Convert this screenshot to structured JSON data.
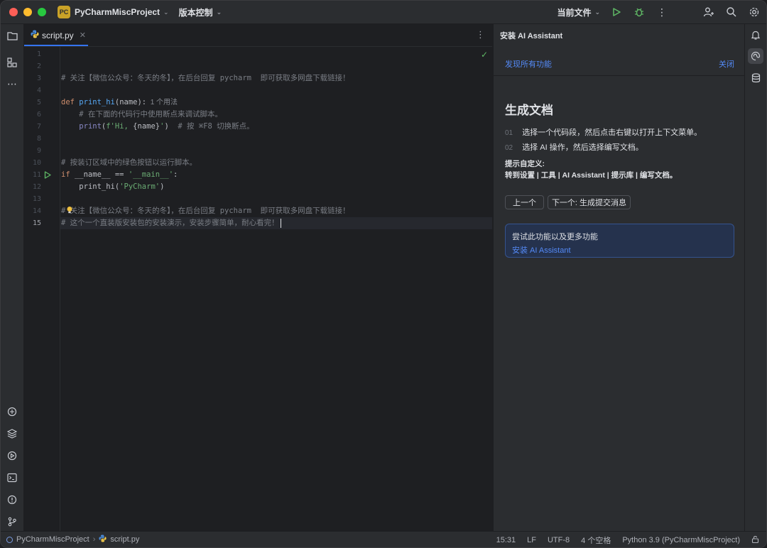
{
  "titlebar": {
    "project_badge": "PC",
    "project_name": "PyCharmMiscProject",
    "vcs_label": "版本控制",
    "run_config": "当前文件"
  },
  "editor": {
    "tab_label": "script.py",
    "lines": [
      {
        "n": "1"
      },
      {
        "n": "2"
      },
      {
        "n": "3",
        "comment": "# 关注【微信公众号：冬天的冬】，在后台回复 pycharm  即可获取多网盘下载链接！"
      },
      {
        "n": "4"
      },
      {
        "n": "5",
        "kw": "def ",
        "fn": "print_hi",
        "rest": "(name):",
        "hint": "1 个用法"
      },
      {
        "n": "6",
        "indent": "    ",
        "comment": "# 在下面的代码行中使用断点来调试脚本。"
      },
      {
        "n": "7",
        "indent": "    ",
        "call": "print",
        "open": "(",
        "str": "f'Hi, ",
        "brace": "{name}",
        "str_end": "'",
        "close": ")",
        "comment": "  # 按 ⌘F8 切换断点。"
      },
      {
        "n": "8"
      },
      {
        "n": "9"
      },
      {
        "n": "10",
        "comment": "# 按装订区域中的绿色按钮以运行脚本。"
      },
      {
        "n": "11",
        "kw": "if ",
        "rest": "__name__ == ",
        "str": "'__main__'",
        "rest2": ":"
      },
      {
        "n": "12",
        "indent": "    ",
        "rest": "print_hi(",
        "str": "'PyCharm'",
        "rest2": ")"
      },
      {
        "n": "13"
      },
      {
        "n": "14",
        "comment": "# 关注【微信公众号：冬天的冬】，在后台回复 pycharm  即可获取多网盘下载链接！"
      },
      {
        "n": "15",
        "comment": "# 这个一个直装版安装包的安装演示，安装步骤简单，耐心看完！"
      }
    ]
  },
  "ai_panel": {
    "title": "安装 AI Assistant",
    "discover_link": "发现所有功能",
    "close_link": "关闭",
    "heading": "生成文档",
    "steps": [
      {
        "num": "01",
        "text": "选择一个代码段，然后点击右键以打开上下文菜单。"
      },
      {
        "num": "02",
        "text": "选择 AI 操作，然后选择编写文档。"
      }
    ],
    "tip_label": "提示自定义:",
    "tip_path": "转到设置 | 工具 | AI Assistant | 提示库 | 编写文档。",
    "prev_button": "上一个",
    "next_button": "下一个: 生成提交消息",
    "try_text": "尝试此功能以及更多功能",
    "install_link": "安装 AI Assistant"
  },
  "statusbar": {
    "project": "PyCharmMiscProject",
    "file": "script.py",
    "position": "15:31",
    "line_ending": "LF",
    "encoding": "UTF-8",
    "indent": "4 个空格",
    "interpreter": "Python 3.9 (PyCharmMiscProject)"
  },
  "colors": {
    "accent": "#3574f0",
    "link": "#548af7",
    "run_green": "#5fb865"
  }
}
